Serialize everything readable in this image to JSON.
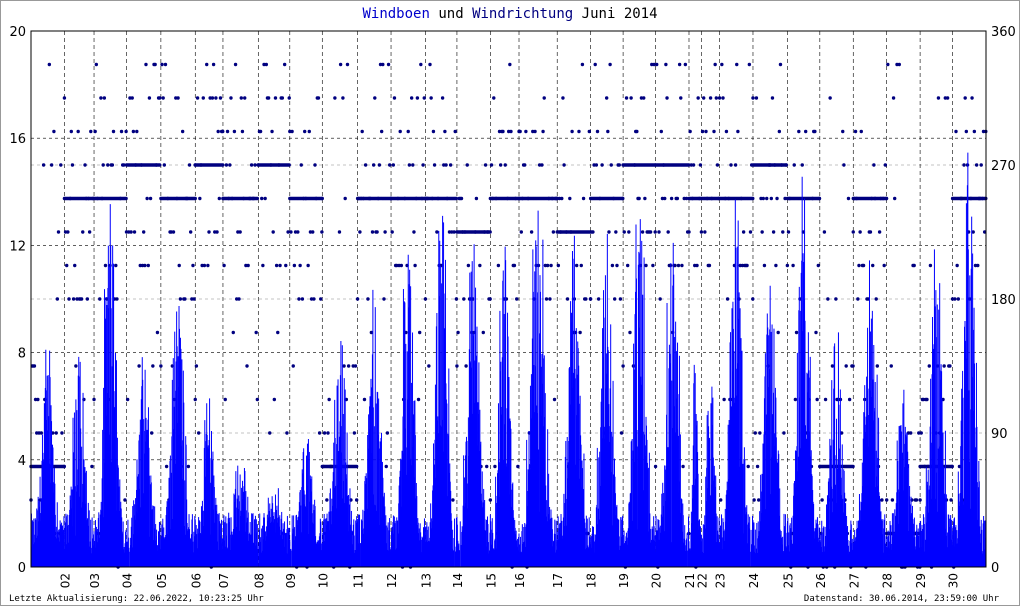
{
  "chart_data": {
    "type": "bar",
    "title": {
      "part1": "Windboen",
      "part2": "und",
      "part3": "Windrichtung",
      "part4": "Juni 2014"
    },
    "xlabel": "",
    "ylabel": "",
    "y2label": "",
    "ylim": [
      0,
      20
    ],
    "y2lim": [
      0,
      360
    ],
    "yticks": [
      "0",
      "4",
      "8",
      "12",
      "16",
      "20"
    ],
    "y2ticks": [
      "0",
      "90",
      "180",
      "270",
      "360"
    ],
    "x_total_samples": 1000,
    "day_labels": [
      {
        "label": "02",
        "x": 35
      },
      {
        "label": "03",
        "x": 66
      },
      {
        "label": "04",
        "x": 100
      },
      {
        "label": "05",
        "x": 136
      },
      {
        "label": "06",
        "x": 172
      },
      {
        "label": "07",
        "x": 201
      },
      {
        "label": "08",
        "x": 238
      },
      {
        "label": "09",
        "x": 271
      },
      {
        "label": "10",
        "x": 305
      },
      {
        "label": "11",
        "x": 342
      },
      {
        "label": "12",
        "x": 377
      },
      {
        "label": "13",
        "x": 413
      },
      {
        "label": "14",
        "x": 446
      },
      {
        "label": "15",
        "x": 481
      },
      {
        "label": "16",
        "x": 511
      },
      {
        "label": "17",
        "x": 551
      },
      {
        "label": "18",
        "x": 586
      },
      {
        "label": "19",
        "x": 620
      },
      {
        "label": "20",
        "x": 654
      },
      {
        "label": "21",
        "x": 689
      },
      {
        "label": "22",
        "x": 702
      },
      {
        "label": "23",
        "x": 721
      },
      {
        "label": "24",
        "x": 756
      },
      {
        "label": "25",
        "x": 792
      },
      {
        "label": "26",
        "x": 826
      },
      {
        "label": "27",
        "x": 861
      },
      {
        "label": "28",
        "x": 896
      },
      {
        "label": "29",
        "x": 931
      },
      {
        "label": "30",
        "x": 965
      }
    ],
    "daily_peak_gust": [
      8.3,
      8.5,
      13.8,
      7.7,
      11.2,
      6.8,
      4.0,
      3.0,
      5.0,
      8.6,
      10.5,
      12.3,
      13.5,
      12.3,
      12.3,
      14.0,
      12.5,
      12.3,
      14.0,
      12.3,
      9.0,
      9.0,
      13.8,
      11.0,
      14.8,
      9.0,
      11.2,
      6.5,
      12.2,
      15.7
    ],
    "direction_step_deg": 22.5,
    "dominant_direction_deg": [
      67.5,
      247.5,
      247.5,
      270,
      247.5,
      270,
      247.5,
      270,
      247.5,
      67.5,
      247.5,
      247.5,
      247.5,
      225,
      247.5,
      247.5,
      225,
      247.5,
      270,
      270,
      247.5,
      247.5,
      247.5,
      270,
      247.5,
      67.5,
      247.5,
      22.5,
      67.5,
      247.5
    ],
    "colors": {
      "gust": "#0000ff",
      "direction": "#000080",
      "grid": "#000000"
    }
  },
  "footer": {
    "left": "Letzte Aktualisierung: 22.06.2022, 10:23:25 Uhr",
    "right": "Datenstand: 30.06.2014, 23:59:00 Uhr"
  }
}
